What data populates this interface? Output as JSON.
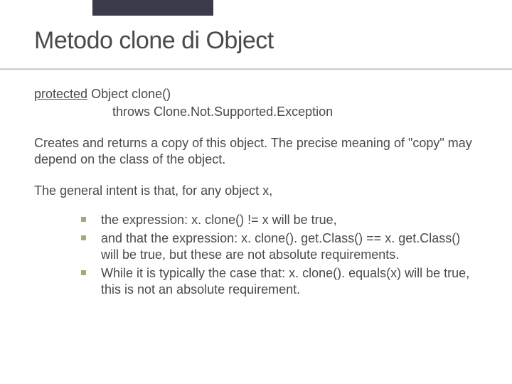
{
  "title": "Metodo clone di Object",
  "signature": {
    "protected": "protected",
    "rest_line1": " Object clone()",
    "line2": "throws Clone.Not.Supported.Exception"
  },
  "para1": "Creates and returns a copy of this object. The precise meaning of \"copy\" may depend on the class of the object.",
  "para2": "The general intent is that, for any object x,",
  "bullets": [
    "the expression:  x. clone() != x will be true,",
    "and that the expression:  x. clone(). get.Class() == x. get.Class() will be true, but these are not absolute requirements.",
    "While it is typically the case that: x. clone(). equals(x) will be true, this is not an absolute requirement."
  ]
}
